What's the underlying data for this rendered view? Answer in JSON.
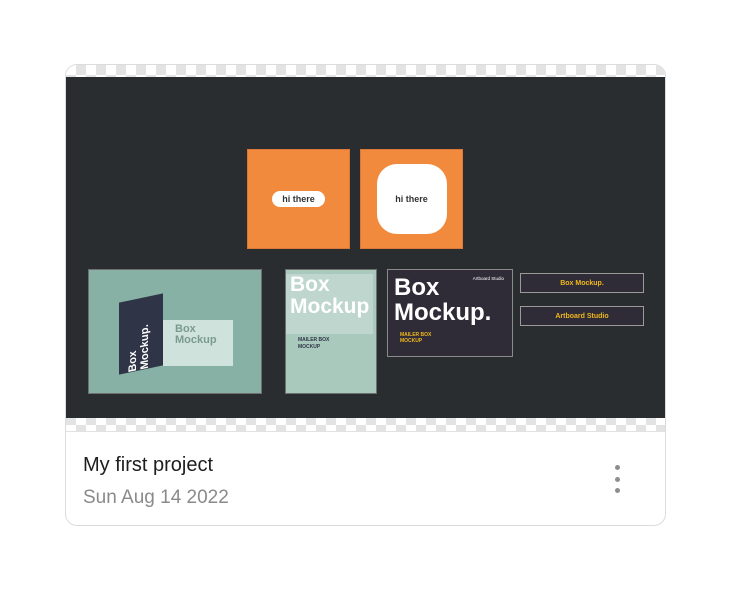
{
  "project": {
    "title": "My first project",
    "date": "Sun Aug 14 2022"
  },
  "preview": {
    "hi_there_1": "hi there",
    "hi_there_2": "hi there",
    "box_word": "Box",
    "mockup_word": "Mockup",
    "mockup_word_dot": "Mockup.",
    "mailer_1": "MAILER BOX",
    "mailer_2": "MOCKUP",
    "artboard_studio": "Artboard Studio",
    "box_mockup_small": "Box Mockup.",
    "artboard_small": "Artboard Studio"
  },
  "icons": {
    "menu": "kebab-menu-icon"
  },
  "colors": {
    "canvas_bg": "#2a2d2f",
    "orange": "#f28a3d",
    "accent_yellow": "#f0b81c"
  }
}
